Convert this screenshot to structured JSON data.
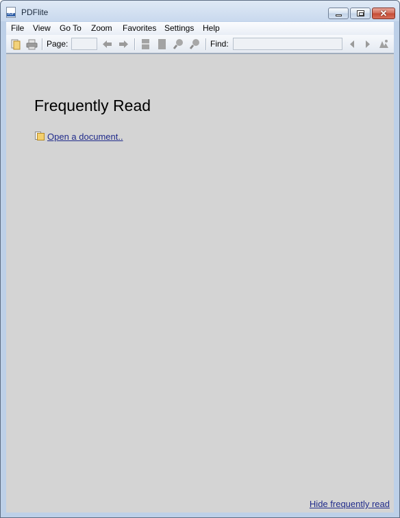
{
  "window": {
    "title": "PDFlite",
    "app_icon_text": "PDF"
  },
  "menu": [
    "File",
    "View",
    "Go To",
    "Zoom",
    "Favorites",
    "Settings",
    "Help"
  ],
  "toolbar": {
    "page_label": "Page:",
    "page_value": "",
    "find_label": "Find:",
    "find_value": ""
  },
  "main": {
    "heading": "Frequently Read",
    "open_link": "Open a document..",
    "hide_link": "Hide frequently read"
  },
  "colors": {
    "content_bg": "#d4d4d4",
    "link": "#1f2a8a",
    "frame": "#bdd0e8"
  }
}
